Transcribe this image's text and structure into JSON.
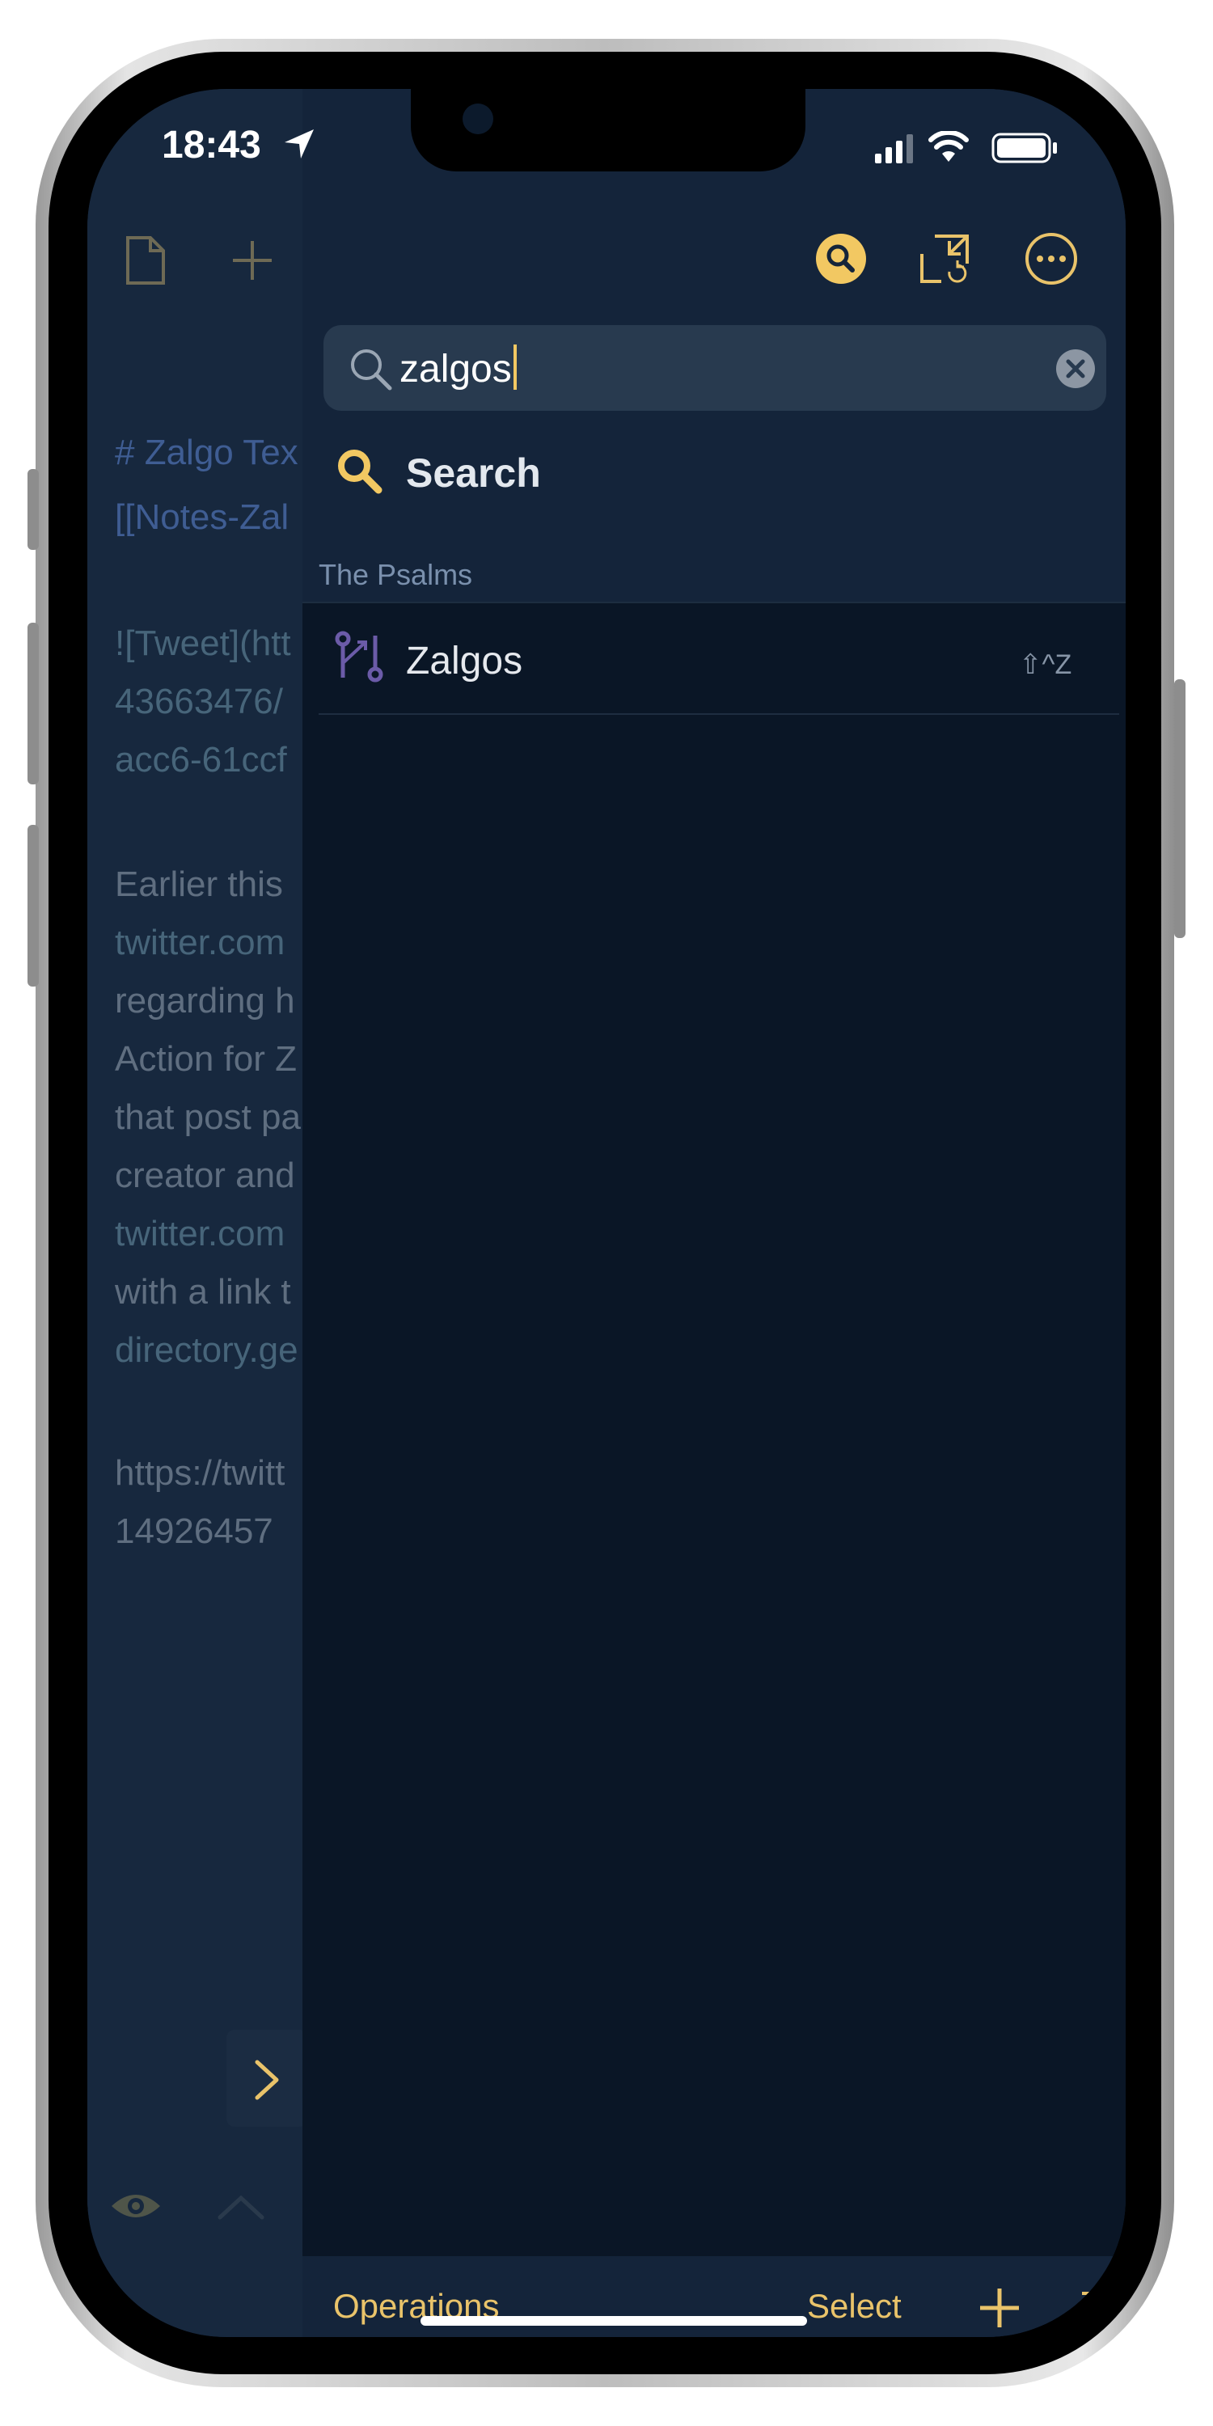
{
  "status_bar": {
    "time": "18:43"
  },
  "editor": {
    "lines": [
      "# Zalgo Tex",
      "[[Notes-Zal",
      "![Tweet](htt",
      "43663476/",
      "acc6-61ccf",
      "Earlier this",
      "twitter.com",
      "regarding h",
      "Action for Z",
      "that post pa",
      "creator and",
      "twitter.com",
      "with a link t",
      "directory.ge",
      "https://twitt",
      "14926457"
    ]
  },
  "search": {
    "value": "zalgos",
    "search_action_label": "Search",
    "section_label": "The Psalms",
    "results": [
      {
        "label": "Zalgos",
        "shortcut": "⇧^Z"
      }
    ]
  },
  "bottom_toolbar": {
    "operations_label": "Operations",
    "select_label": "Select"
  },
  "colors": {
    "accent": "#f2c862",
    "panel_bg": "#0a1626",
    "header_bg": "#14243a",
    "field_bg": "#283a4f"
  }
}
